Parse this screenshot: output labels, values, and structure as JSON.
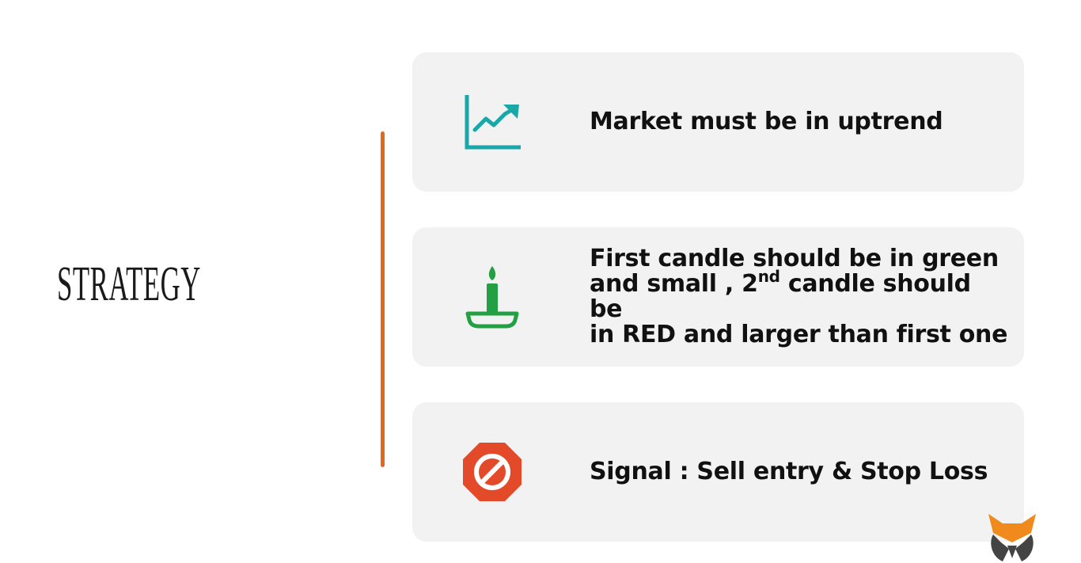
{
  "slide": {
    "title": "STRATEGY",
    "accent_color": "#e06a1a"
  },
  "cards": [
    {
      "icon": "uptrend-chart-icon",
      "icon_color": "#1aa7a8",
      "text": "Market must be in uptrend"
    },
    {
      "icon": "candle-icon",
      "icon_color": "#23a043",
      "line1": "First candle should be in green",
      "line2_pre": "and small , 2",
      "line2_sup": "nd",
      "line2_post": " candle should be",
      "line3": "in RED and larger than first one"
    },
    {
      "icon": "stop-sign-icon",
      "icon_color": "#e34a2a",
      "text": "Signal : Sell entry & Stop Loss"
    }
  ],
  "logo": {
    "icon": "fox-logo-icon",
    "colors": [
      "#f08a1c",
      "#444444"
    ]
  }
}
